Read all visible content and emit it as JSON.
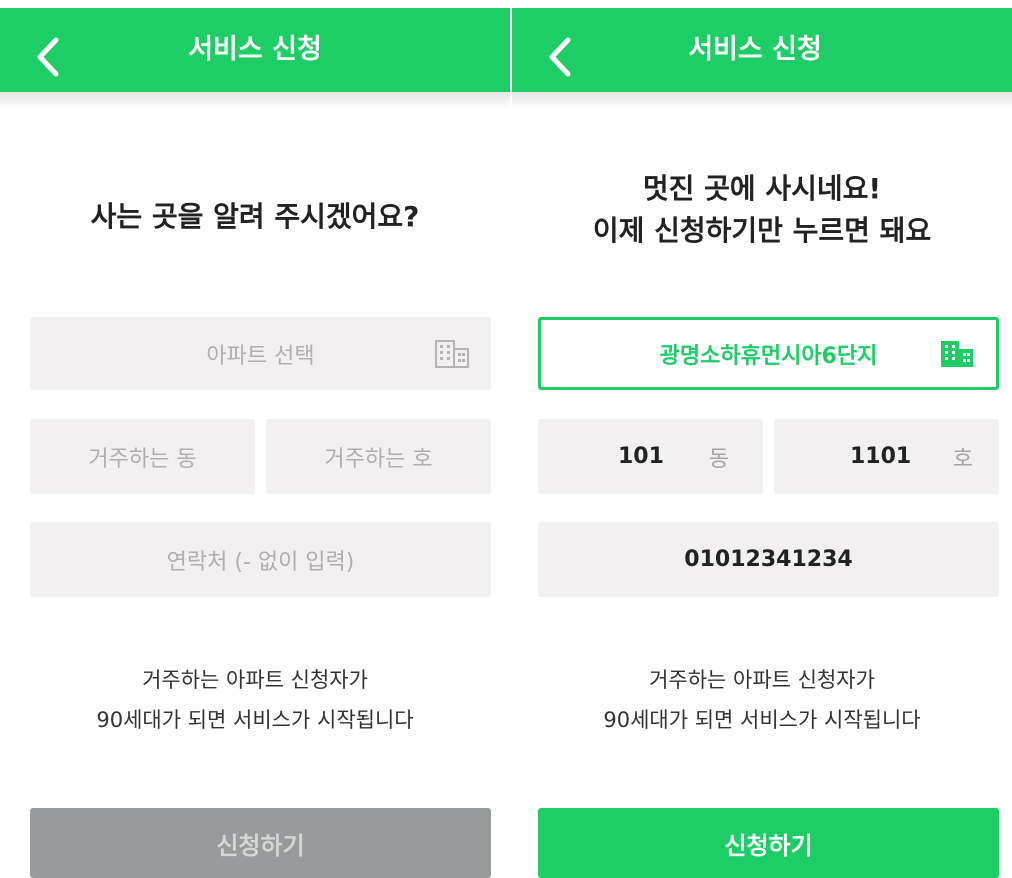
{
  "colors": {
    "accent": "#1ecd66",
    "field_bg": "#f2f0f0",
    "disabled_button": "#979b9b"
  },
  "left_screen": {
    "header": {
      "back_icon": "chevron-left-icon",
      "title": "서비스 신청"
    },
    "heading": "사는 곳을 알려 주시겠어요?",
    "apartment_field": {
      "placeholder": "아파트 선택",
      "icon": "building-icon"
    },
    "dong_field": {
      "placeholder": "거주하는 동"
    },
    "ho_field": {
      "placeholder": "거주하는 호"
    },
    "phone_field": {
      "placeholder": "연락처 (- 없이 입력)"
    },
    "notice": {
      "line1": "거주하는 아파트 신청자가",
      "line2": "90세대가 되면 서비스가 시작됩니다"
    },
    "submit": {
      "label": "신청하기",
      "state": "disabled"
    }
  },
  "right_screen": {
    "header": {
      "back_icon": "chevron-left-icon",
      "title": "서비스 신청"
    },
    "heading": {
      "line1": "멋진 곳에 사시네요!",
      "line2": "이제 신청하기만 누르면 돼요"
    },
    "apartment_field": {
      "value": "광명소하휴먼시아6단지",
      "icon": "building-icon"
    },
    "dong_field": {
      "value": "101",
      "unit": "동"
    },
    "ho_field": {
      "value": "1101",
      "unit": "호"
    },
    "phone_field": {
      "value": "01012341234"
    },
    "notice": {
      "line1": "거주하는 아파트 신청자가",
      "line2": "90세대가 되면 서비스가 시작됩니다"
    },
    "submit": {
      "label": "신청하기",
      "state": "enabled"
    }
  }
}
